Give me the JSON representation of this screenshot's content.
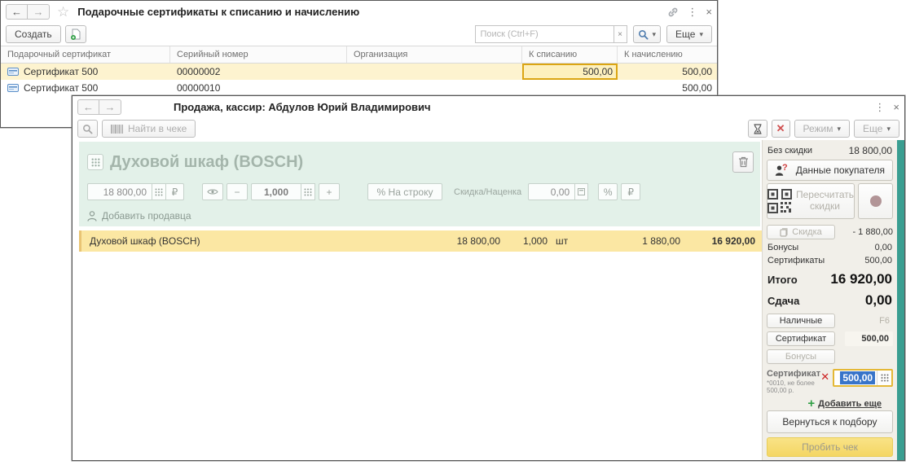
{
  "certificates_window": {
    "title": "Подарочные сертификаты к списанию и начислению",
    "toolbar": {
      "create_label": "Создать",
      "search_placeholder": "Поиск (Ctrl+F)",
      "more_label": "Еще"
    },
    "table": {
      "columns": [
        "Подарочный сертификат",
        "Серийный номер",
        "Организация",
        "К списанию",
        "К начислению"
      ],
      "rows": [
        {
          "certificate": "Сертификат 500",
          "serial": "00000002",
          "organization": "",
          "writeoff": "500,00",
          "accrual": "500,00"
        },
        {
          "certificate": "Сертификат 500",
          "serial": "00000010",
          "organization": "",
          "writeoff": "",
          "accrual": "500,00"
        }
      ]
    }
  },
  "sale_window": {
    "title": "Продажа, кассир: Абдулов Юрий Владимирович",
    "toolbar": {
      "find_label": "Найти в чеке",
      "mode_label": "Режим",
      "more_label": "Еще"
    },
    "product_panel": {
      "name": "Духовой шкаф (BOSCH)",
      "price": "18 800,00",
      "currency": "₽",
      "quantity": "1,000",
      "minus": "−",
      "plus": "+",
      "per_line_label": "% На строку",
      "discount_label": "Скидка/Наценка",
      "discount_value": "0,00",
      "percent_label": "%",
      "add_seller_label": "Добавить продавца"
    },
    "receipt_row": {
      "name": "Духовой шкаф (BOSCH)",
      "price": "18 800,00",
      "qty": "1,000",
      "unit": "шт",
      "discount": "1 880,00",
      "total": "16 920,00"
    },
    "summary": {
      "no_discount_label": "Без скидки",
      "no_discount_value": "18 800,00",
      "customer_data_label": "Данные покупателя",
      "recalc_line1": "Пересчитать",
      "recalc_line2": "скидки",
      "discount_label": "Скидка",
      "discount_value": "- 1 880,00",
      "bonuses_label": "Бонусы",
      "bonuses_value": "0,00",
      "certificates_label": "Сертификаты",
      "certificates_value": "500,00",
      "total_label": "Итого",
      "total_value": "16 920,00",
      "change_label": "Сдача",
      "change_value": "0,00"
    },
    "payments": {
      "cash_label": "Наличные",
      "cash_hotkey": "F6",
      "certificate_label": "Сертификат",
      "certificate_value": "500,00",
      "bonuses_label": "Бонусы",
      "applied_certificate": {
        "label": "Сертификат",
        "note": "*0010, не более 500,00 р.",
        "amount": "500,00"
      },
      "add_more_label": "Добавить еще"
    },
    "footer": {
      "back_label": "Вернуться к подбору",
      "submit_label": "Пробить чек"
    },
    "accent_colors": {
      "teal": "#3a9e91",
      "selected_row": "#fbe7a3",
      "submit_yellow": "#f4d663"
    }
  }
}
